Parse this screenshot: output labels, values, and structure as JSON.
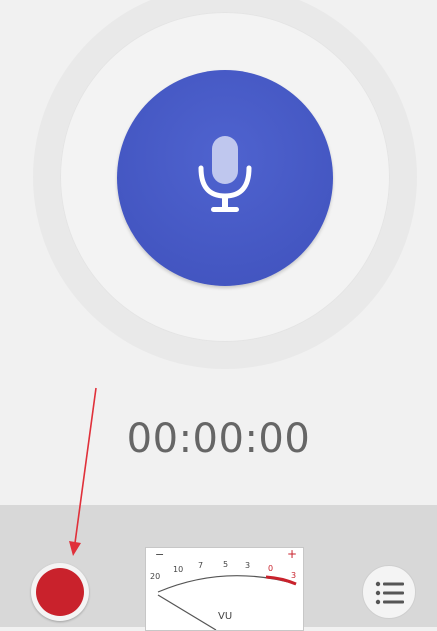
{
  "timer": {
    "display": "00:00:00"
  },
  "vu_meter": {
    "minus_label": "−",
    "plus_label": "+",
    "scale": [
      "20",
      "10",
      "7",
      "5",
      "3",
      "0",
      "3"
    ],
    "label": "VU",
    "accent_color": "#c9222c"
  },
  "icons": {
    "mic": "microphone-icon",
    "record": "record-icon",
    "list": "list-icon"
  },
  "colors": {
    "mic_button": "#3f51bc",
    "record": "#c9222c",
    "annotation_arrow": "#e0303a"
  }
}
